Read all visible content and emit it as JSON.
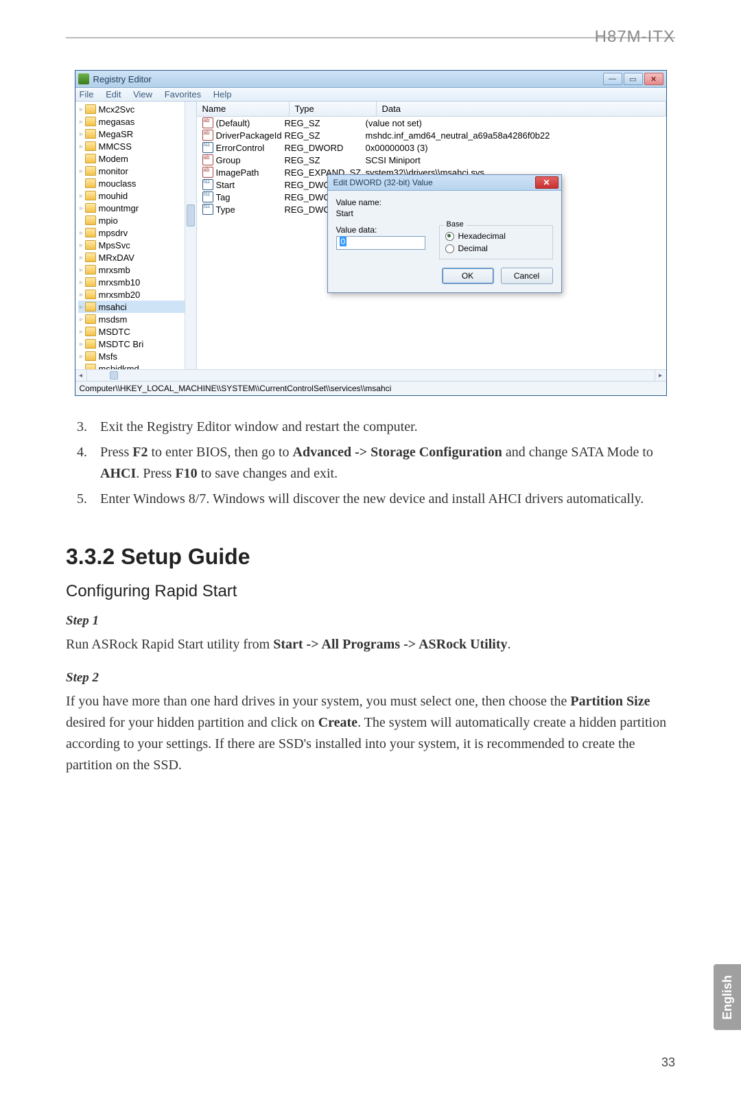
{
  "doc_header": "H87M-ITX",
  "side_tab": "English",
  "page_number": "33",
  "regedit": {
    "title": "Registry Editor",
    "menubar": [
      "File",
      "Edit",
      "View",
      "Favorites",
      "Help"
    ],
    "tree": [
      {
        "name": "Mcx2Svc",
        "arrow": "▹"
      },
      {
        "name": "megasas",
        "arrow": "▹"
      },
      {
        "name": "MegaSR",
        "arrow": "▹"
      },
      {
        "name": "MMCSS",
        "arrow": "▹"
      },
      {
        "name": "Modem",
        "arrow": ""
      },
      {
        "name": "monitor",
        "arrow": "▹"
      },
      {
        "name": "mouclass",
        "arrow": ""
      },
      {
        "name": "mouhid",
        "arrow": "▹"
      },
      {
        "name": "mountmgr",
        "arrow": "▹"
      },
      {
        "name": "mpio",
        "arrow": ""
      },
      {
        "name": "mpsdrv",
        "arrow": "▹"
      },
      {
        "name": "MpsSvc",
        "arrow": "▹"
      },
      {
        "name": "MRxDAV",
        "arrow": "▹"
      },
      {
        "name": "mrxsmb",
        "arrow": "▹"
      },
      {
        "name": "mrxsmb10",
        "arrow": "▹"
      },
      {
        "name": "mrxsmb20",
        "arrow": "▹"
      },
      {
        "name": "msahci",
        "arrow": "▹",
        "sel": true
      },
      {
        "name": "msdsm",
        "arrow": "▹"
      },
      {
        "name": "MSDTC",
        "arrow": "▹"
      },
      {
        "name": "MSDTC Bri",
        "arrow": "▹"
      },
      {
        "name": "Msfs",
        "arrow": "▹"
      },
      {
        "name": "mshidkmd",
        "arrow": ""
      }
    ],
    "columns": {
      "name": "Name",
      "type": "Type",
      "data": "Data"
    },
    "values": [
      {
        "ico": "ab",
        "name": "(Default)",
        "type": "REG_SZ",
        "data": "(value not set)"
      },
      {
        "ico": "ab",
        "name": "DriverPackageId",
        "type": "REG_SZ",
        "data": "mshdc.inf_amd64_neutral_a69a58a4286f0b22"
      },
      {
        "ico": "bin",
        "name": "ErrorControl",
        "type": "REG_DWORD",
        "data": "0x00000003 (3)"
      },
      {
        "ico": "ab",
        "name": "Group",
        "type": "REG_SZ",
        "data": "SCSI Miniport"
      },
      {
        "ico": "ab",
        "name": "ImagePath",
        "type": "REG_EXPAND_SZ",
        "data": "system32\\\\drivers\\\\msahci.sys"
      },
      {
        "ico": "bin",
        "name": "Start",
        "type": "REG_DWORD",
        "data": ""
      },
      {
        "ico": "bin",
        "name": "Tag",
        "type": "REG_DWORD",
        "data": ""
      },
      {
        "ico": "bin",
        "name": "Type",
        "type": "REG_DWORD",
        "data": ""
      }
    ],
    "dialog": {
      "title": "Edit DWORD (32-bit) Value",
      "value_name_label": "Value name:",
      "value_name": "Start",
      "value_data_label": "Value data:",
      "value_data": "0",
      "base_label": "Base",
      "hex": "Hexadecimal",
      "dec": "Decimal",
      "ok": "OK",
      "cancel": "Cancel"
    },
    "status": "Computer\\\\HKEY_LOCAL_MACHINE\\\\SYSTEM\\\\CurrentControlSet\\\\services\\\\msahci"
  },
  "list": {
    "start": 3,
    "i3": "Exit the Registry Editor window and restart the computer.",
    "i4_a": "Press ",
    "i4_f2": "F2",
    "i4_b": " to enter BIOS, then go to ",
    "i4_adv": "Advanced -> Storage Configuration",
    "i4_c": " and change SATA Mode to ",
    "i4_ahci": "AHCI",
    "i4_d": ". Press ",
    "i4_f10": "F10",
    "i4_e": " to save changes and exit.",
    "i5": "Enter Windows 8/7. Windows will discover the new device and install AHCI drivers automatically."
  },
  "section_heading": "3.3.2  Setup Guide",
  "subsection_heading": "Configuring Rapid Start",
  "step1_label": "Step 1",
  "step1_a": "Run ASRock Rapid Start utility from ",
  "step1_b": "Start -> All Programs -> ASRock Utility",
  "step1_c": ".",
  "step2_label": "Step 2",
  "step2_a": "If you have more than one hard drives in your system, you must select one, then choose the ",
  "step2_b": "Partition Size",
  "step2_c": " desired for your hidden partition and click on ",
  "step2_d": "Create",
  "step2_e": ". The system will automatically create a hidden partition according to your settings. If there are SSD's installed into your system, it is recommended to create the partition on the SSD."
}
